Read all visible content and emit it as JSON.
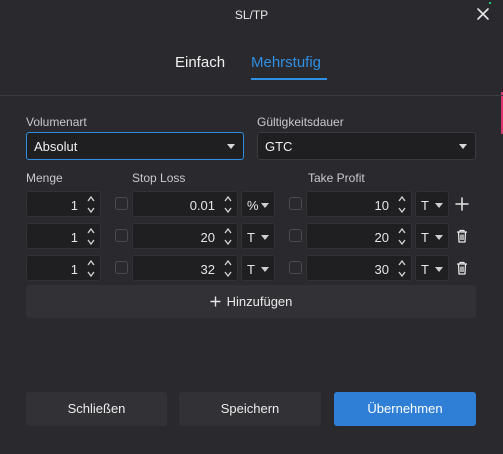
{
  "window": {
    "title": "SL/TP"
  },
  "tabs": [
    {
      "label": "Einfach"
    },
    {
      "label": "Mehrstufig"
    }
  ],
  "volume_type": {
    "label": "Volumenart",
    "value": "Absolut"
  },
  "validity": {
    "label": "Gültigkeitsdauer",
    "value": "GTC"
  },
  "columns": {
    "quantity": "Menge",
    "stop_loss": "Stop Loss",
    "take_profit": "Take Profit"
  },
  "rows": [
    {
      "qty": "1",
      "sl_value": "0.01",
      "sl_unit": "%",
      "tp_value": "10",
      "tp_unit": "T",
      "action": "plus-icon"
    },
    {
      "qty": "1",
      "sl_value": "20",
      "sl_unit": "T",
      "tp_value": "20",
      "tp_unit": "T",
      "action": "trash-icon"
    },
    {
      "qty": "1",
      "sl_value": "32",
      "sl_unit": "T",
      "tp_value": "30",
      "tp_unit": "T",
      "action": "trash-icon"
    }
  ],
  "add_button": {
    "label": "Hinzufügen"
  },
  "footer": {
    "close": "Schließen",
    "save": "Speichern",
    "apply": "Übernehmen"
  },
  "colors": {
    "accent": "#2f8fe3",
    "primary_button": "#2f7fd6",
    "background": "#2a2a2e"
  }
}
